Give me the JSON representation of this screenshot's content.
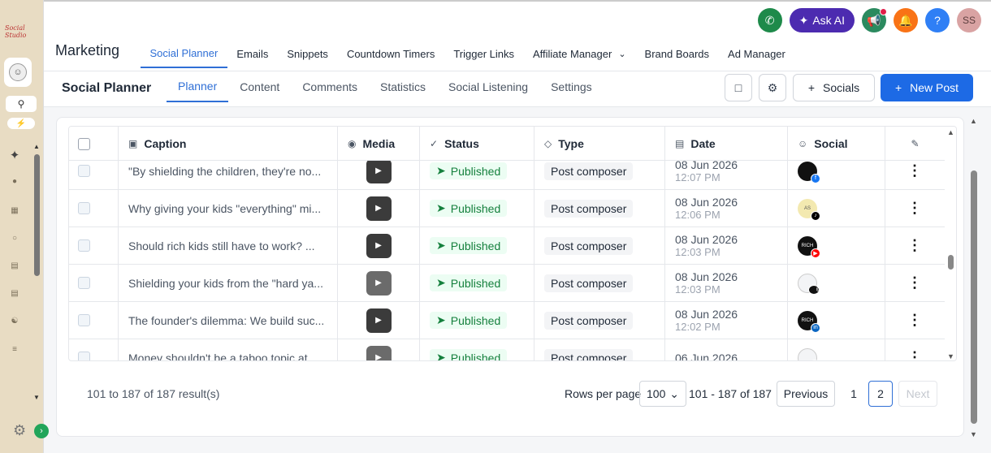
{
  "rail": {
    "logo": "Social Studio",
    "icons": [
      "user-circle-icon",
      "search-icon",
      "bolt-icon",
      "sparkle-icon",
      "mic-icon",
      "grid-icon",
      "chat-icon",
      "calendar-icon",
      "calendar-icon",
      "network-icon",
      "list-icon",
      "gear-icon",
      "chevron-right-icon"
    ]
  },
  "topbar": {
    "ask_ai": "Ask AI",
    "user_initials": "SS",
    "help": "?"
  },
  "mainnav": {
    "title": "Marketing",
    "links": [
      {
        "label": "Social Planner",
        "active": true
      },
      {
        "label": "Emails"
      },
      {
        "label": "Snippets"
      },
      {
        "label": "Countdown Timers"
      },
      {
        "label": "Trigger Links"
      },
      {
        "label": "Affiliate Manager",
        "dropdown": true
      },
      {
        "label": "Brand Boards"
      },
      {
        "label": "Ad Manager"
      }
    ]
  },
  "subnav": {
    "title": "Social Planner",
    "tabs": [
      {
        "label": "Planner",
        "active": true
      },
      {
        "label": "Content"
      },
      {
        "label": "Comments"
      },
      {
        "label": "Statistics"
      },
      {
        "label": "Social Listening"
      },
      {
        "label": "Settings"
      }
    ],
    "socials_label": "Socials",
    "new_post_label": "New Post"
  },
  "table": {
    "headers": {
      "caption": "Caption",
      "media": "Media",
      "status": "Status",
      "type": "Type",
      "date": "Date",
      "social": "Social"
    },
    "rows": [
      {
        "caption": "\"By shielding the children, they're no...",
        "media": "dark",
        "status": "Published",
        "type": "Post composer",
        "date": "08 Jun 2026",
        "time": "12:07 PM",
        "avatar": "dark",
        "avatar_text": "",
        "platform": "fb"
      },
      {
        "caption": "Why giving your kids \"everything\" mi...",
        "media": "dark",
        "status": "Published",
        "type": "Post composer",
        "date": "08 Jun 2026",
        "time": "12:06 PM",
        "avatar": "light",
        "avatar_text": "AS",
        "platform": "tt"
      },
      {
        "caption": "Should rich kids still have to work? ...",
        "media": "dark",
        "status": "Published",
        "type": "Post composer",
        "date": "08 Jun 2026",
        "time": "12:03 PM",
        "avatar": "dark",
        "avatar_text": "RICH",
        "platform": "yt"
      },
      {
        "caption": "Shielding your kids from the \"hard ya...",
        "media": "grey",
        "status": "Published",
        "type": "Post composer",
        "date": "08 Jun 2026",
        "time": "12:03 PM",
        "avatar": "white",
        "avatar_text": "",
        "platform": "th"
      },
      {
        "caption": "The founder's dilemma: We build suc...",
        "media": "dark",
        "status": "Published",
        "type": "Post composer",
        "date": "08 Jun 2026",
        "time": "12:02 PM",
        "avatar": "dark",
        "avatar_text": "RICH",
        "platform": "li"
      },
      {
        "caption": "Money shouldn't be a taboo topic at ...",
        "media": "grey",
        "status": "Published",
        "type": "Post composer",
        "date": "06 Jun 2026",
        "time": "",
        "avatar": "white",
        "avatar_text": "",
        "platform": "ig"
      }
    ]
  },
  "footer": {
    "result_count": "101 to 187 of 187 result(s)",
    "rows_per_page_label": "Rows per page",
    "rows_per_page_value": "100",
    "range": "101 - 187 of 187",
    "previous": "Previous",
    "page1": "1",
    "page2": "2",
    "next": "Next"
  }
}
